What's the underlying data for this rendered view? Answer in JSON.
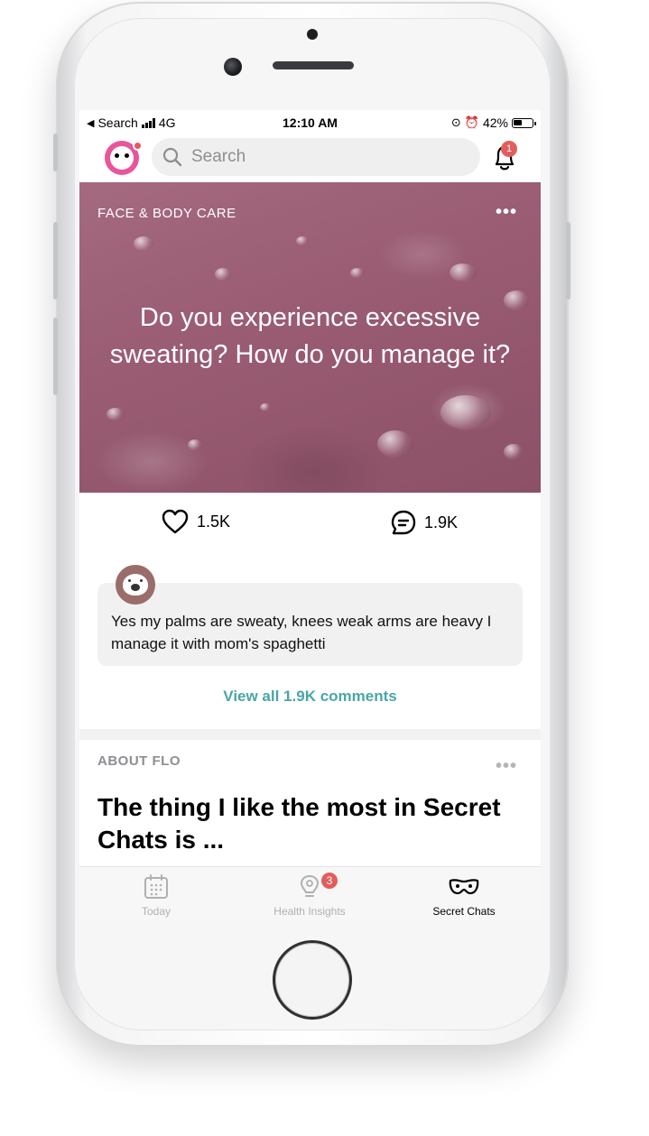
{
  "status_bar": {
    "back_app": "Search",
    "network": "4G",
    "time": "12:10 AM",
    "battery": "42%"
  },
  "header": {
    "search_placeholder": "Search",
    "notification_count": "1",
    "avatar_icon": "panda-avatar-icon"
  },
  "post": {
    "category": "FACE & BODY CARE",
    "more_label": "•••",
    "title": "Do you experience excessive sweating? How do you manage it?",
    "likes": "1.5K",
    "comments": "1.9K",
    "top_comment": "Yes my palms are sweaty, knees weak arms are heavy I manage it with mom's spaghetti",
    "view_all_label": "View all 1.9K comments"
  },
  "post2": {
    "category": "ABOUT FLO",
    "more_label": "•••",
    "title": "The thing I like the most in Secret Chats is ..."
  },
  "tabs": [
    {
      "label": "Today",
      "icon": "calendar-icon",
      "active": false
    },
    {
      "label": "Health Insights",
      "icon": "lightbulb-icon",
      "badge": "3",
      "active": false
    },
    {
      "label": "Secret Chats",
      "icon": "mask-icon",
      "active": true
    }
  ],
  "colors": {
    "accent": "#4aa6a6",
    "badge": "#e35d5d",
    "hero_bg": "#9a5d73",
    "avatar_pink": "#e8559b"
  }
}
